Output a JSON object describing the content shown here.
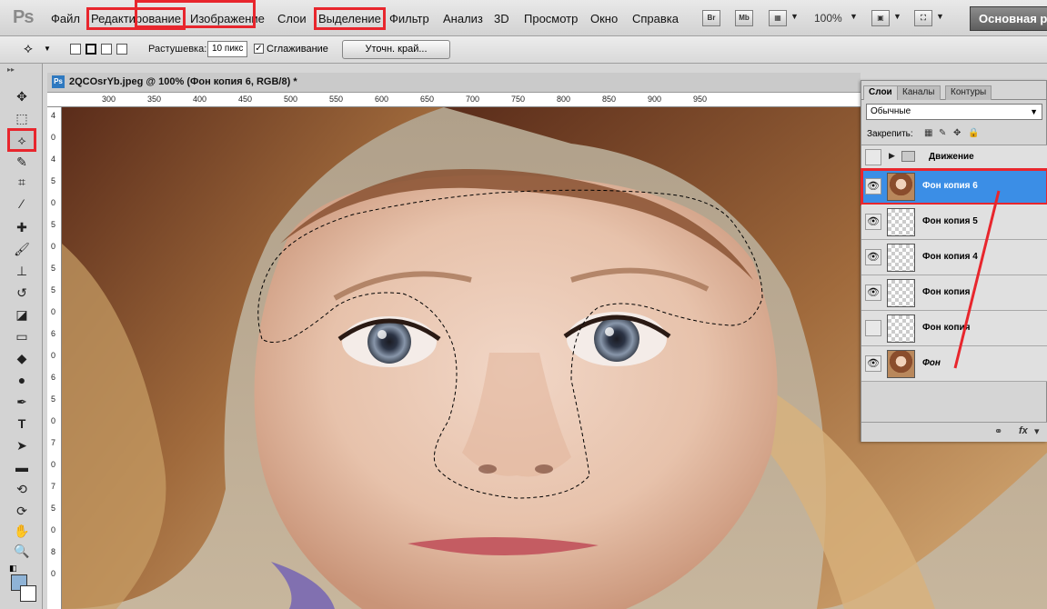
{
  "app": {
    "logo": "Ps"
  },
  "menu": [
    {
      "label": "Файл",
      "highlighted": false
    },
    {
      "label": "Редактирование",
      "highlighted": true
    },
    {
      "label": "Изображение",
      "highlighted": false
    },
    {
      "label": "Слои",
      "highlighted": false
    },
    {
      "label": "Выделение",
      "highlighted": true
    },
    {
      "label": "Фильтр",
      "highlighted": false
    },
    {
      "label": "Анализ",
      "highlighted": false
    },
    {
      "label": "3D",
      "highlighted": false
    },
    {
      "label": "Просмотр",
      "highlighted": false
    },
    {
      "label": "Окно",
      "highlighted": false
    },
    {
      "label": "Справка",
      "highlighted": false
    }
  ],
  "menubar_icons": {
    "bridge": "Br",
    "minibridge": "Mb"
  },
  "zoom": "100%",
  "workspace": "Основная рабочая среда",
  "options": {
    "feather_label": "Растушевка:",
    "feather_value": "10 пикс",
    "smoothing_label": "Сглаживание",
    "smoothing_checked": true,
    "refine_edge": "Уточн. край..."
  },
  "tools": [
    "move-icon",
    "marquee-icon",
    "polygonal-lasso-icon",
    "quick-selection-icon",
    "crop-icon",
    "eyedropper-icon",
    "spot-healing-icon",
    "brush-icon",
    "clone-stamp-icon",
    "history-brush-icon",
    "eraser-icon",
    "gradient-icon",
    "blur-icon",
    "dodge-icon",
    "pen-icon",
    "type-icon",
    "path-selection-icon",
    "rectangle-icon",
    "3d-rotate-icon",
    "3d-orbit-icon",
    "hand-icon",
    "zoom-icon"
  ],
  "active_tool": "polygonal-lasso-icon",
  "colors": {
    "foreground": "#8fb3d6",
    "background": "#ffffff",
    "highlight": "#e8262d",
    "selected_layer": "#3b8ee6"
  },
  "document": {
    "title": "2QCOsrYb.jpeg @ 100% (Фон копия 6, RGB/8) *",
    "tab_icon": "Ps"
  },
  "ruler_top": [
    "300",
    "350",
    "400",
    "450",
    "500",
    "550",
    "600",
    "650",
    "700",
    "750",
    "800",
    "850",
    "900",
    "950"
  ],
  "ruler_left": [
    "4",
    "0",
    "4",
    "5",
    "0",
    "5",
    "0",
    "5",
    "5",
    "0",
    "6",
    "0",
    "6",
    "5",
    "0",
    "7",
    "0",
    "7",
    "5",
    "0",
    "8",
    "0"
  ],
  "layers_panel": {
    "tabs": [
      {
        "label": "Слои",
        "active": true
      },
      {
        "label": "Каналы",
        "active": false
      },
      {
        "label": "Контуры",
        "active": false
      }
    ],
    "blend_mode": "Обычные",
    "lock_label": "Закрепить:",
    "layers": [
      {
        "name": "Движение",
        "type": "group",
        "visible": false,
        "selected": false
      },
      {
        "name": "Фон копия 6",
        "type": "photo",
        "visible": true,
        "selected": true
      },
      {
        "name": "Фон копия 5",
        "type": "transparent",
        "visible": true,
        "selected": false
      },
      {
        "name": "Фон копия 4",
        "type": "transparent",
        "visible": true,
        "selected": false
      },
      {
        "name": "Фон копия",
        "type": "transparent",
        "visible": true,
        "selected": false
      },
      {
        "name": "Фон копия",
        "type": "transparent",
        "visible": false,
        "selected": false
      },
      {
        "name": "Фон",
        "type": "photo",
        "visible": true,
        "selected": false,
        "italic": true
      }
    ],
    "footer": {
      "link": "link-icon",
      "fx": "fx"
    }
  }
}
